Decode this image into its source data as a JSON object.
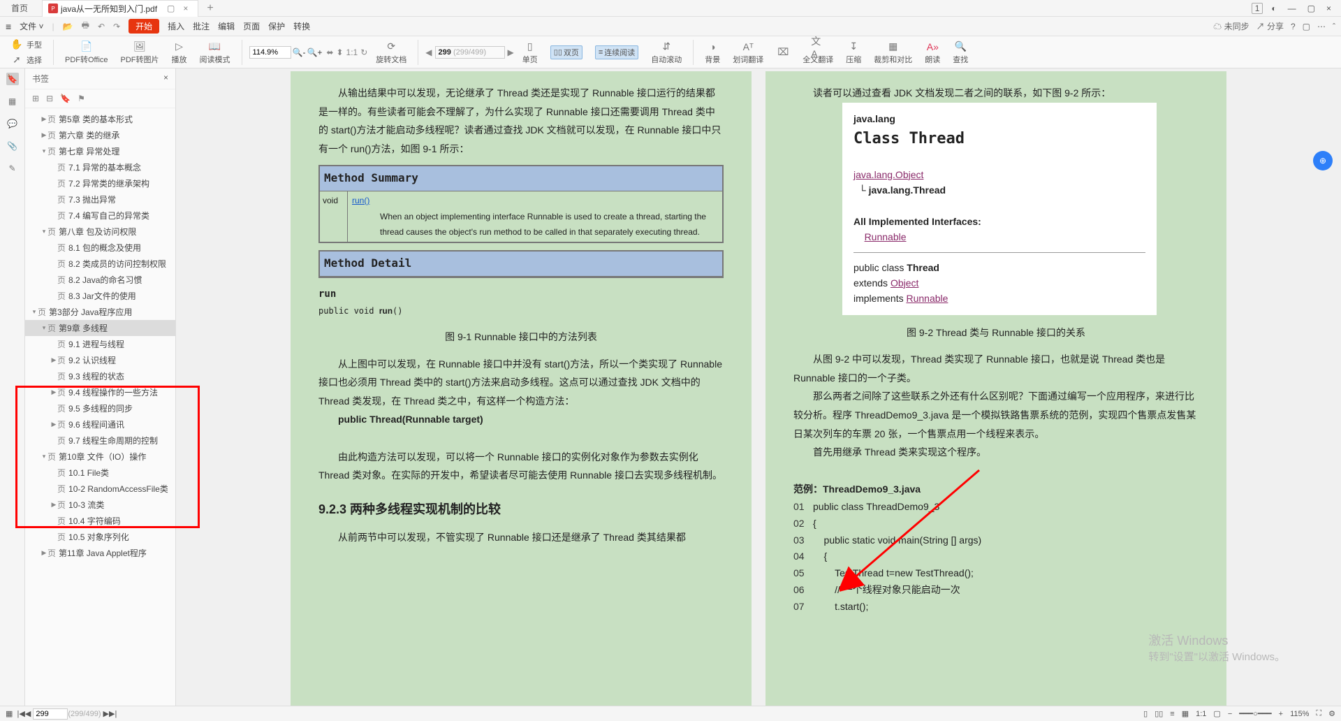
{
  "tabs": {
    "home": "首页",
    "file": "java从一无所知到入门.pdf",
    "badge": "1"
  },
  "menu": {
    "file": "文件",
    "start": "开始",
    "items": [
      "插入",
      "批注",
      "编辑",
      "页面",
      "保护",
      "转换"
    ],
    "right": {
      "unsync": "未同步",
      "share": "分享"
    }
  },
  "toolbar": {
    "hand": "手型",
    "select": "选择",
    "pdf2office": "PDF转Office",
    "pdf2img": "PDF转图片",
    "play": "播放",
    "readmode": "阅读模式",
    "zoom": "114.9%",
    "rotate": "旋转文档",
    "page_cur": "299",
    "page_total": "(299/499)",
    "single": "单页",
    "double": "双页",
    "continuous": "连续阅读",
    "autoscroll": "自动滚动",
    "bg": "背景",
    "seltrans": "划词翻译",
    "fulltrans": "全文翻译",
    "compress": "压缩",
    "crop": "裁剪和对比",
    "read": "朗读",
    "search": "查找"
  },
  "sidebar": {
    "title": "书签",
    "items": [
      {
        "lvl": 1,
        "tw": "▶",
        "pg": "页",
        "t": "第5章  类的基本形式"
      },
      {
        "lvl": 1,
        "tw": "▶",
        "pg": "页",
        "t": "第六章  类的继承"
      },
      {
        "lvl": 1,
        "tw": "▾",
        "pg": "页",
        "t": "第七章  异常处理"
      },
      {
        "lvl": 2,
        "tw": "",
        "pg": "页",
        "t": "7.1  异常的基本概念"
      },
      {
        "lvl": 2,
        "tw": "",
        "pg": "页",
        "t": "7.2  异常类的继承架构"
      },
      {
        "lvl": 2,
        "tw": "",
        "pg": "页",
        "t": "7.3  抛出异常"
      },
      {
        "lvl": 2,
        "tw": "",
        "pg": "页",
        "t": "7.4  编写自己的异常类"
      },
      {
        "lvl": 1,
        "tw": "▾",
        "pg": "页",
        "t": "第八章  包及访问权限"
      },
      {
        "lvl": 2,
        "tw": "",
        "pg": "页",
        "t": "8.1  包的概念及使用"
      },
      {
        "lvl": 2,
        "tw": "",
        "pg": "页",
        "t": "8.2  类成员的访问控制权限"
      },
      {
        "lvl": 2,
        "tw": "",
        "pg": "页",
        "t": "8.2  Java的命名习惯"
      },
      {
        "lvl": 2,
        "tw": "",
        "pg": "页",
        "t": "8.3  Jar文件的使用"
      },
      {
        "lvl": 0,
        "tw": "▾",
        "pg": "页",
        "t": "第3部分  Java程序应用"
      },
      {
        "lvl": 1,
        "tw": "▾",
        "pg": "页",
        "t": "第9章  多线程",
        "sel": true
      },
      {
        "lvl": 2,
        "tw": "",
        "pg": "页",
        "t": "9.1  进程与线程"
      },
      {
        "lvl": 2,
        "tw": "▶",
        "pg": "页",
        "t": "9.2  认识线程"
      },
      {
        "lvl": 2,
        "tw": "",
        "pg": "页",
        "t": "9.3  线程的状态"
      },
      {
        "lvl": 2,
        "tw": "▶",
        "pg": "页",
        "t": "9.4  线程操作的一些方法"
      },
      {
        "lvl": 2,
        "tw": "",
        "pg": "页",
        "t": "9.5  多线程的同步"
      },
      {
        "lvl": 2,
        "tw": "▶",
        "pg": "页",
        "t": "9.6  线程间通讯"
      },
      {
        "lvl": 2,
        "tw": "",
        "pg": "页",
        "t": "9.7  线程生命周期的控制"
      },
      {
        "lvl": 1,
        "tw": "▾",
        "pg": "页",
        "t": "第10章 文件（IO）操作"
      },
      {
        "lvl": 2,
        "tw": "",
        "pg": "页",
        "t": "10.1  File类"
      },
      {
        "lvl": 2,
        "tw": "",
        "pg": "页",
        "t": "10-2  RandomAccessFile类"
      },
      {
        "lvl": 2,
        "tw": "▶",
        "pg": "页",
        "t": "10-3  流类"
      },
      {
        "lvl": 2,
        "tw": "",
        "pg": "页",
        "t": "10.4  字符编码"
      },
      {
        "lvl": 2,
        "tw": "",
        "pg": "页",
        "t": "10.5  对象序列化"
      },
      {
        "lvl": 1,
        "tw": "▶",
        "pg": "页",
        "t": "第11章 Java Applet程序"
      }
    ]
  },
  "page_left": {
    "p1": "从输出结果中可以发现，无论继承了 Thread 类还是实现了 Runnable 接口运行的结果都是一样的。有些读者可能会不理解了，为什么实现了 Runnable 接口还需要调用 Thread 类中的 start()方法才能启动多线程呢？读者通过查找 JDK 文档就可以发现，在 Runnable 接口中只有一个 run()方法，如图 9-1 所示：",
    "ms_title": "Method Summary",
    "ms_void": "void",
    "ms_run": "run()",
    "ms_desc": "When an object implementing interface Runnable is used to create a thread, starting the thread causes the object's run method to be called in that separately executing thread.",
    "md_title": "Method Detail",
    "md_run": "run",
    "md_sig": "public void run()",
    "fig1": "图 9-1    Runnable 接口中的方法列表",
    "p2": "从上图中可以发现，在 Runnable 接口中并没有 start()方法，所以一个类实现了 Runnable 接口也必须用 Thread 类中的 start()方法来启动多线程。这点可以通过查找 JDK 文档中的 Thread 类发现，在 Thread 类之中，有这样一个构造方法：",
    "ctor": "public Thread(Runnable target)",
    "p3": "由此构造方法可以发现，可以将一个 Runnable 接口的实例化对象作为参数去实例化 Thread 类对象。在实际的开发中，希望读者尽可能去使用 Runnable 接口去实现多线程机制。",
    "h923": "9.2.3  两种多线程实现机制的比较",
    "p4": "从前两节中可以发现，不管实现了 Runnable 接口还是继承了 Thread 类其结果都"
  },
  "page_right": {
    "p1": "读者可以通过查看 JDK 文档发现二者之间的联系，如下图 9-2 所示：",
    "jd_pkg": "java.lang",
    "jd_cls": "Class Thread",
    "jd_obj": "java.lang.Object",
    "jd_thr": "java.lang.Thread",
    "jd_impl": "All Implemented Interfaces:",
    "jd_runnable": "Runnable",
    "jd_sig1": "public class ",
    "jd_sig1b": "Thread",
    "jd_sig2a": "extends ",
    "jd_sig2b": "Object",
    "jd_sig3a": "implements ",
    "jd_sig3b": "Runnable",
    "fig2": "图 9-2    Thread 类与 Runnable 接口的关系",
    "p2": "从图 9-2 中可以发现，Thread 类实现了 Runnable 接口，也就是说 Thread 类也是 Runnable 接口的一个子类。",
    "p3": "那么两者之间除了这些联系之外还有什么区别呢？下面通过编写一个应用程序，来进行比较分析。程序 ThreadDemo9_3.java 是一个模拟铁路售票系统的范例，实现四个售票点发售某日某次列车的车票 20 张，一个售票点用一个线程来表示。",
    "p4": "首先用继承 Thread 类来实现这个程序。",
    "ex_title": "范例：ThreadDemo9_3.java",
    "code": [
      {
        "n": "01",
        "c": "public class ThreadDemo9_3"
      },
      {
        "n": "02",
        "c": "{"
      },
      {
        "n": "03",
        "c": "    public static void main(String [] args)"
      },
      {
        "n": "04",
        "c": "    {"
      },
      {
        "n": "05",
        "c": "        TestThread t=new TestThread();"
      },
      {
        "n": "06",
        "c": "        // 一个线程对象只能启动一次"
      },
      {
        "n": "07",
        "c": "        t.start();"
      }
    ]
  },
  "watermark": {
    "l1": "激活 Windows",
    "l2": "转到\"设置\"以激活 Windows。"
  },
  "status": {
    "page": "299",
    "total": "(299/499)",
    "zoom": "115%"
  }
}
